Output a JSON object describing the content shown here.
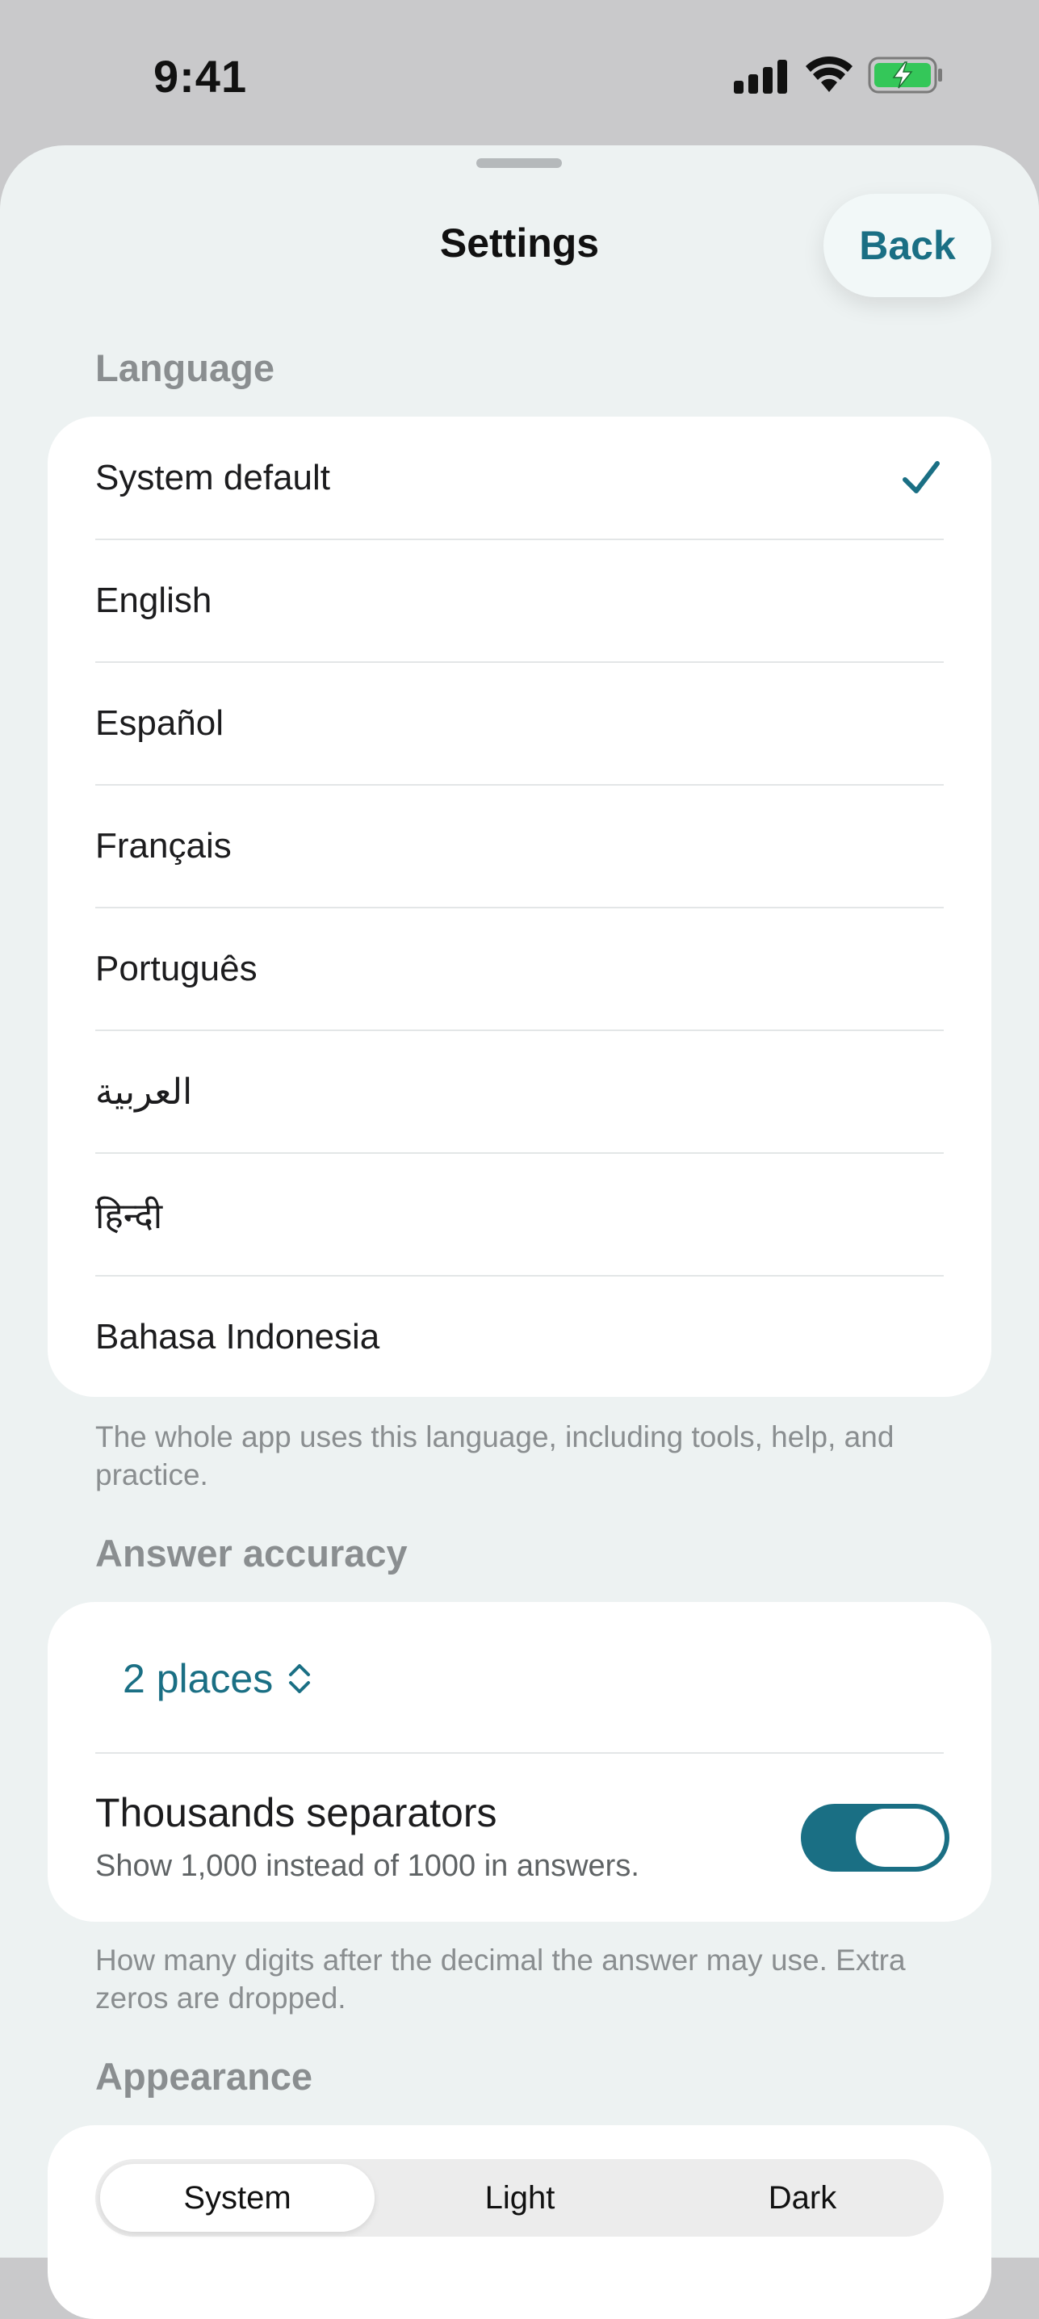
{
  "status_bar": {
    "time": "9:41",
    "icons": [
      "cellular-signal-icon",
      "wifi-icon",
      "battery-charging-icon"
    ],
    "battery_color": "#34c759"
  },
  "header": {
    "title": "Settings",
    "back_label": "Back"
  },
  "language": {
    "heading": "Language",
    "options": [
      {
        "label": "System default",
        "selected": true
      },
      {
        "label": "English",
        "selected": false
      },
      {
        "label": "Español",
        "selected": false
      },
      {
        "label": "Français",
        "selected": false
      },
      {
        "label": "Português",
        "selected": false
      },
      {
        "label": "العربية",
        "selected": false
      },
      {
        "label": "हिन्दी",
        "selected": false
      },
      {
        "label": "Bahasa Indonesia",
        "selected": false
      }
    ],
    "footnote": "The whole app uses this language, including tools, help, and practice."
  },
  "accuracy": {
    "heading": "Answer accuracy",
    "places_value": "2 places",
    "thousands_title": "Thousands separators",
    "thousands_subtitle": "Show 1,000 instead of 1000 in answers.",
    "thousands_enabled": true,
    "footnote": "How many digits after the decimal the answer may use. Extra zeros are dropped."
  },
  "appearance": {
    "heading": "Appearance",
    "options": [
      "System",
      "Light",
      "Dark"
    ],
    "selected": "System"
  },
  "colors": {
    "accent": "#1a6f84",
    "sheet_background": "#edf2f2",
    "card_background": "#ffffff"
  }
}
